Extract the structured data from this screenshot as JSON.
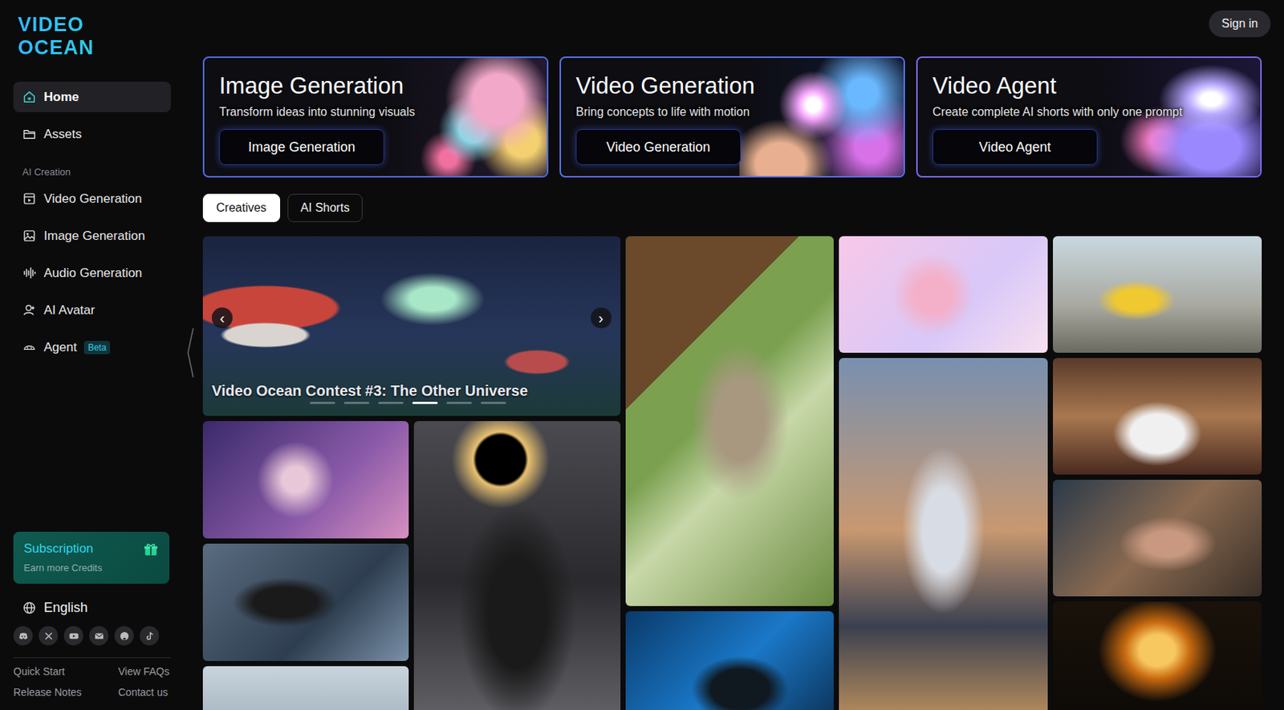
{
  "logo": "VIDEO OCEAN",
  "header": {
    "sign_in": "Sign in"
  },
  "sidebar": {
    "top_items": [
      {
        "label": "Home",
        "selected": true
      },
      {
        "label": "Assets",
        "selected": false
      }
    ],
    "section": "AI Creation",
    "creation_items": [
      {
        "label": "Video Generation",
        "selected": false
      },
      {
        "label": "Image Generation",
        "selected": false
      },
      {
        "label": "Audio Generation",
        "selected": false
      },
      {
        "label": "AI Avatar",
        "selected": false
      },
      {
        "label": "Agent",
        "selected": false,
        "badge": "Beta"
      }
    ],
    "subscription": {
      "title": "Subscription",
      "subtitle": "Earn more Credits"
    },
    "language": "English",
    "footer_links": [
      "Quick Start",
      "View FAQs",
      "Release Notes",
      "Contact us"
    ]
  },
  "feature_cards": [
    {
      "title": "Image Generation",
      "subtitle": "Transform ideas into stunning visuals",
      "button": "Image Generation"
    },
    {
      "title": "Video Generation",
      "subtitle": "Bring concepts to life with motion",
      "button": "Video Generation"
    },
    {
      "title": "Video Agent",
      "subtitle": "Create complete AI shorts with only one prompt",
      "button": "Video Agent"
    }
  ],
  "tabs": [
    {
      "label": "Creatives",
      "selected": true
    },
    {
      "label": "AI Shorts",
      "selected": false
    }
  ],
  "carousel": {
    "title": "Video Ocean Contest #3: The Other Universe",
    "prev": "‹",
    "next": "›",
    "dots": [
      {
        "selected": false
      },
      {
        "selected": false
      },
      {
        "selected": false
      },
      {
        "selected": true
      },
      {
        "selected": false
      },
      {
        "selected": false
      }
    ]
  }
}
